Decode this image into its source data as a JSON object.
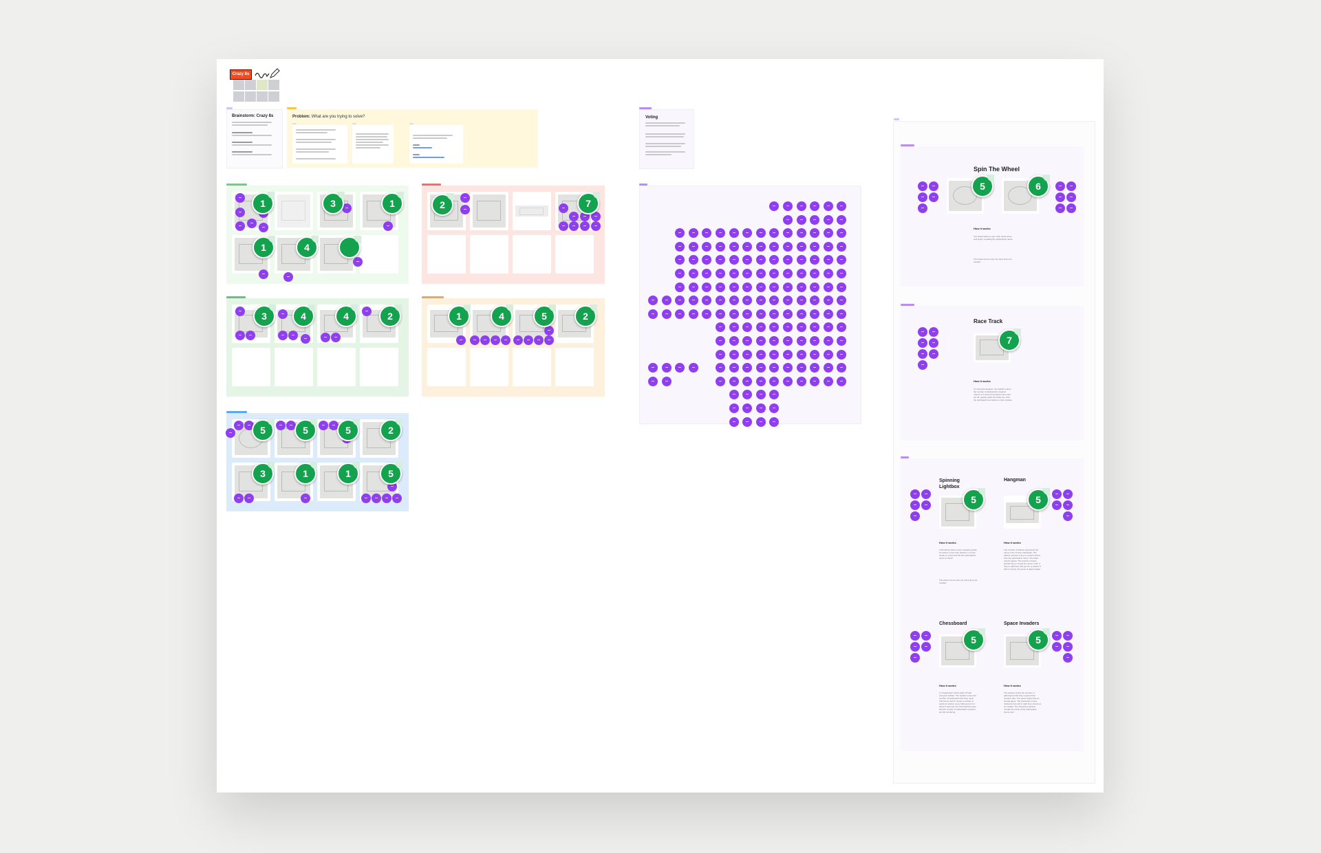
{
  "logo": {
    "badge": "Crazy 8s"
  },
  "intro": {
    "title": "Brainstorm: Crazy 8s",
    "problem_label": "Problem:",
    "problem_question": "What are you trying to solve?"
  },
  "voting": {
    "title": "Voting"
  },
  "frame_scores": {
    "row1_left": [
      "1",
      "3",
      "1",
      "1",
      "4"
    ],
    "row1_right": [
      "2",
      "7"
    ],
    "row2_left": [
      "3",
      "4",
      "4",
      "2"
    ],
    "row2_right": [
      "1",
      "4",
      "5",
      "2"
    ],
    "row3_left": [
      "5",
      "5",
      "5",
      "2",
      "3",
      "1",
      "1",
      "5"
    ]
  },
  "results": {
    "spin_the_wheel": {
      "title": "Spin The Wheel",
      "scores": [
        "5",
        "6"
      ],
      "how_label": "How it works",
      "paragraphs": [
        "The wheel starts to spin, then slows down and stops, revealing the participants name.",
        "The wheel can be spun as many times as needed."
      ]
    },
    "race_track": {
      "title": "Race Track",
      "score": "7",
      "how_label": "How it works",
      "paragraphs": [
        "An racetrack appears, the teacher enters the number of participants required. There’s a 3 second countdown then cars set off, quickly reach the finish line, then the participants are listed in order of place."
      ]
    },
    "spinning_lightbox": {
      "title": "Spinning Lightbox",
      "score": "5",
      "how_label": "How it works",
      "paragraphs": [
        "A 3D wheel starts to spin revealing pupils at random in the main window. It comes slowly to a stop and the first participants name is shown.",
        "The wheel can be spun as many times as needed."
      ]
    },
    "hangman": {
      "title": "Hangman",
      "score": "5",
      "how_label": "How it works",
      "paragraphs": [
        "The number of dashes represents the name of the chosen participant. The teacher presses a key to reveal 3 letters from the participants name. The class need to guess. The teacher presses another key to reveal the name in full. If they’re right then that person is picked. If they’re wrong, the game is played again."
      ]
    },
    "chessboard": {
      "title": "Chessboard",
      "score": "5",
      "how_label": "How it works",
      "paragraphs": [
        "A “chessboard” which starts off with everyone hidden. The teacher enters the number of participants that they need. The boxes start to reveal a number of pupils at random every half-second, for about 5 seconds, then the flashing stops and the number of participants required are left remaining."
      ]
    },
    "space_invaders": {
      "title": "Space Invaders",
      "score": "5",
      "how_label": "How it works",
      "paragraphs": [
        "The teacher enters the number of participants that they required then presses start. The game begins like an arcade game. The spaceship moves randomly from left to right then shoots at an invader. The shooting explosion reveals the name of the participants. Game over."
      ]
    }
  },
  "colors": {
    "accent": "#8f3ff0",
    "sticker": "#14a24f",
    "badge": "#ef4c23",
    "frame_lavender": "#f9f6fd",
    "frame_yellow": "#fff8dc"
  }
}
